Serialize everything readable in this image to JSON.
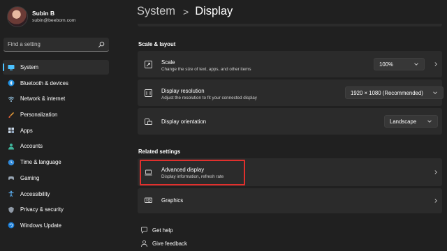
{
  "profile": {
    "name": "Subin B",
    "email": "subin@beebom.com"
  },
  "search": {
    "placeholder": "Find a setting",
    "icon": "search-icon"
  },
  "accent_color": "#4cc2ff",
  "highlight_color": "#e0302d",
  "nav": [
    {
      "label": "System",
      "icon": "monitor-icon",
      "active": true
    },
    {
      "label": "Bluetooth & devices",
      "icon": "bluetooth-icon"
    },
    {
      "label": "Network & internet",
      "icon": "network-icon"
    },
    {
      "label": "Personalization",
      "icon": "brush-icon"
    },
    {
      "label": "Apps",
      "icon": "apps-icon"
    },
    {
      "label": "Accounts",
      "icon": "person-icon"
    },
    {
      "label": "Time & language",
      "icon": "globe-clock-icon"
    },
    {
      "label": "Gaming",
      "icon": "gamepad-icon"
    },
    {
      "label": "Accessibility",
      "icon": "accessibility-icon"
    },
    {
      "label": "Privacy & security",
      "icon": "shield-icon"
    },
    {
      "label": "Windows Update",
      "icon": "update-icon"
    }
  ],
  "breadcrumb": {
    "parent": "System",
    "separator": ">",
    "current": "Display"
  },
  "scale_layout": {
    "heading": "Scale & layout",
    "scale": {
      "title": "Scale",
      "subtitle": "Change the size of text, apps, and other items",
      "value": "100%"
    },
    "resolution": {
      "title": "Display resolution",
      "subtitle": "Adjust the resolution to fit your connected display",
      "value": "1920 × 1080 (Recommended)"
    },
    "orientation": {
      "title": "Display orientation",
      "value": "Landscape"
    }
  },
  "related": {
    "heading": "Related settings",
    "advanced": {
      "title": "Advanced display",
      "subtitle": "Display information, refresh rate"
    },
    "graphics": {
      "title": "Graphics"
    }
  },
  "footer": {
    "help": "Get help",
    "feedback": "Give feedback"
  }
}
